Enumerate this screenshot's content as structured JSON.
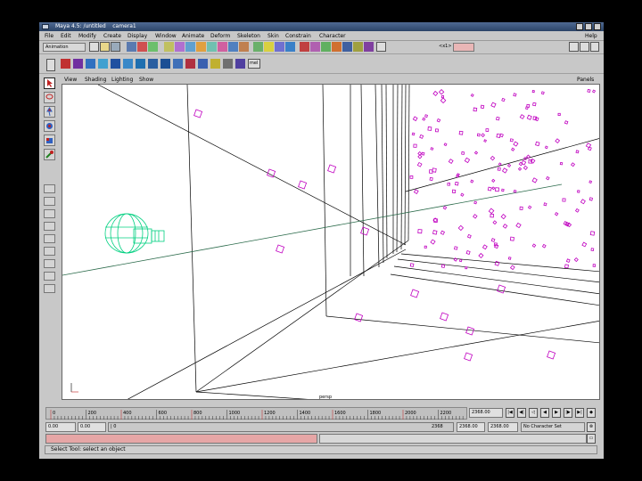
{
  "window": {
    "title": "Maya 4.5: /untitled    camera1"
  },
  "menu": [
    "File",
    "Edit",
    "Modify",
    "Create",
    "Display",
    "Window",
    "Animate",
    "Deform",
    "Skeleton",
    "Skin",
    "Constrain",
    "Character",
    "Help"
  ],
  "shelf": {
    "mode": "Animation",
    "command_label": "mel"
  },
  "status_line": {
    "input_prefix": "<x1>"
  },
  "panel": {
    "menus": [
      "View",
      "Shading",
      "Lighting",
      "Show"
    ],
    "right_menu": "Panels",
    "camera_label": "persp"
  },
  "timeline": {
    "ticks": [
      "0",
      "200",
      "400",
      "600",
      "800",
      "1000",
      "1200",
      "1400",
      "1600",
      "1800",
      "2000",
      "2200"
    ],
    "current_frame": "2368.00"
  },
  "range": {
    "start": "0.00",
    "start_inner": "0.00",
    "inner_marker": "| 0",
    "end_inner": "2368",
    "end": "2368.00",
    "end_outer": "2368.00",
    "character_set": "No Character Set"
  },
  "help_line": "Select Tool: select an object",
  "colors": {
    "ui_gray": "#c8c8c8",
    "title_blue": "#3a5680",
    "camera_green": "#00d080",
    "particle_magenta": "#c000c0",
    "active_red": "#e24040"
  },
  "icons": [
    "select-arrow-icon",
    "lasso-icon",
    "move-icon",
    "rotate-icon",
    "scale-icon",
    "manipulator-icon",
    "rewind-icon",
    "step-back-icon",
    "play-icon",
    "step-forward-icon",
    "fast-forward-icon",
    "key-icon",
    "auto-key-icon"
  ]
}
